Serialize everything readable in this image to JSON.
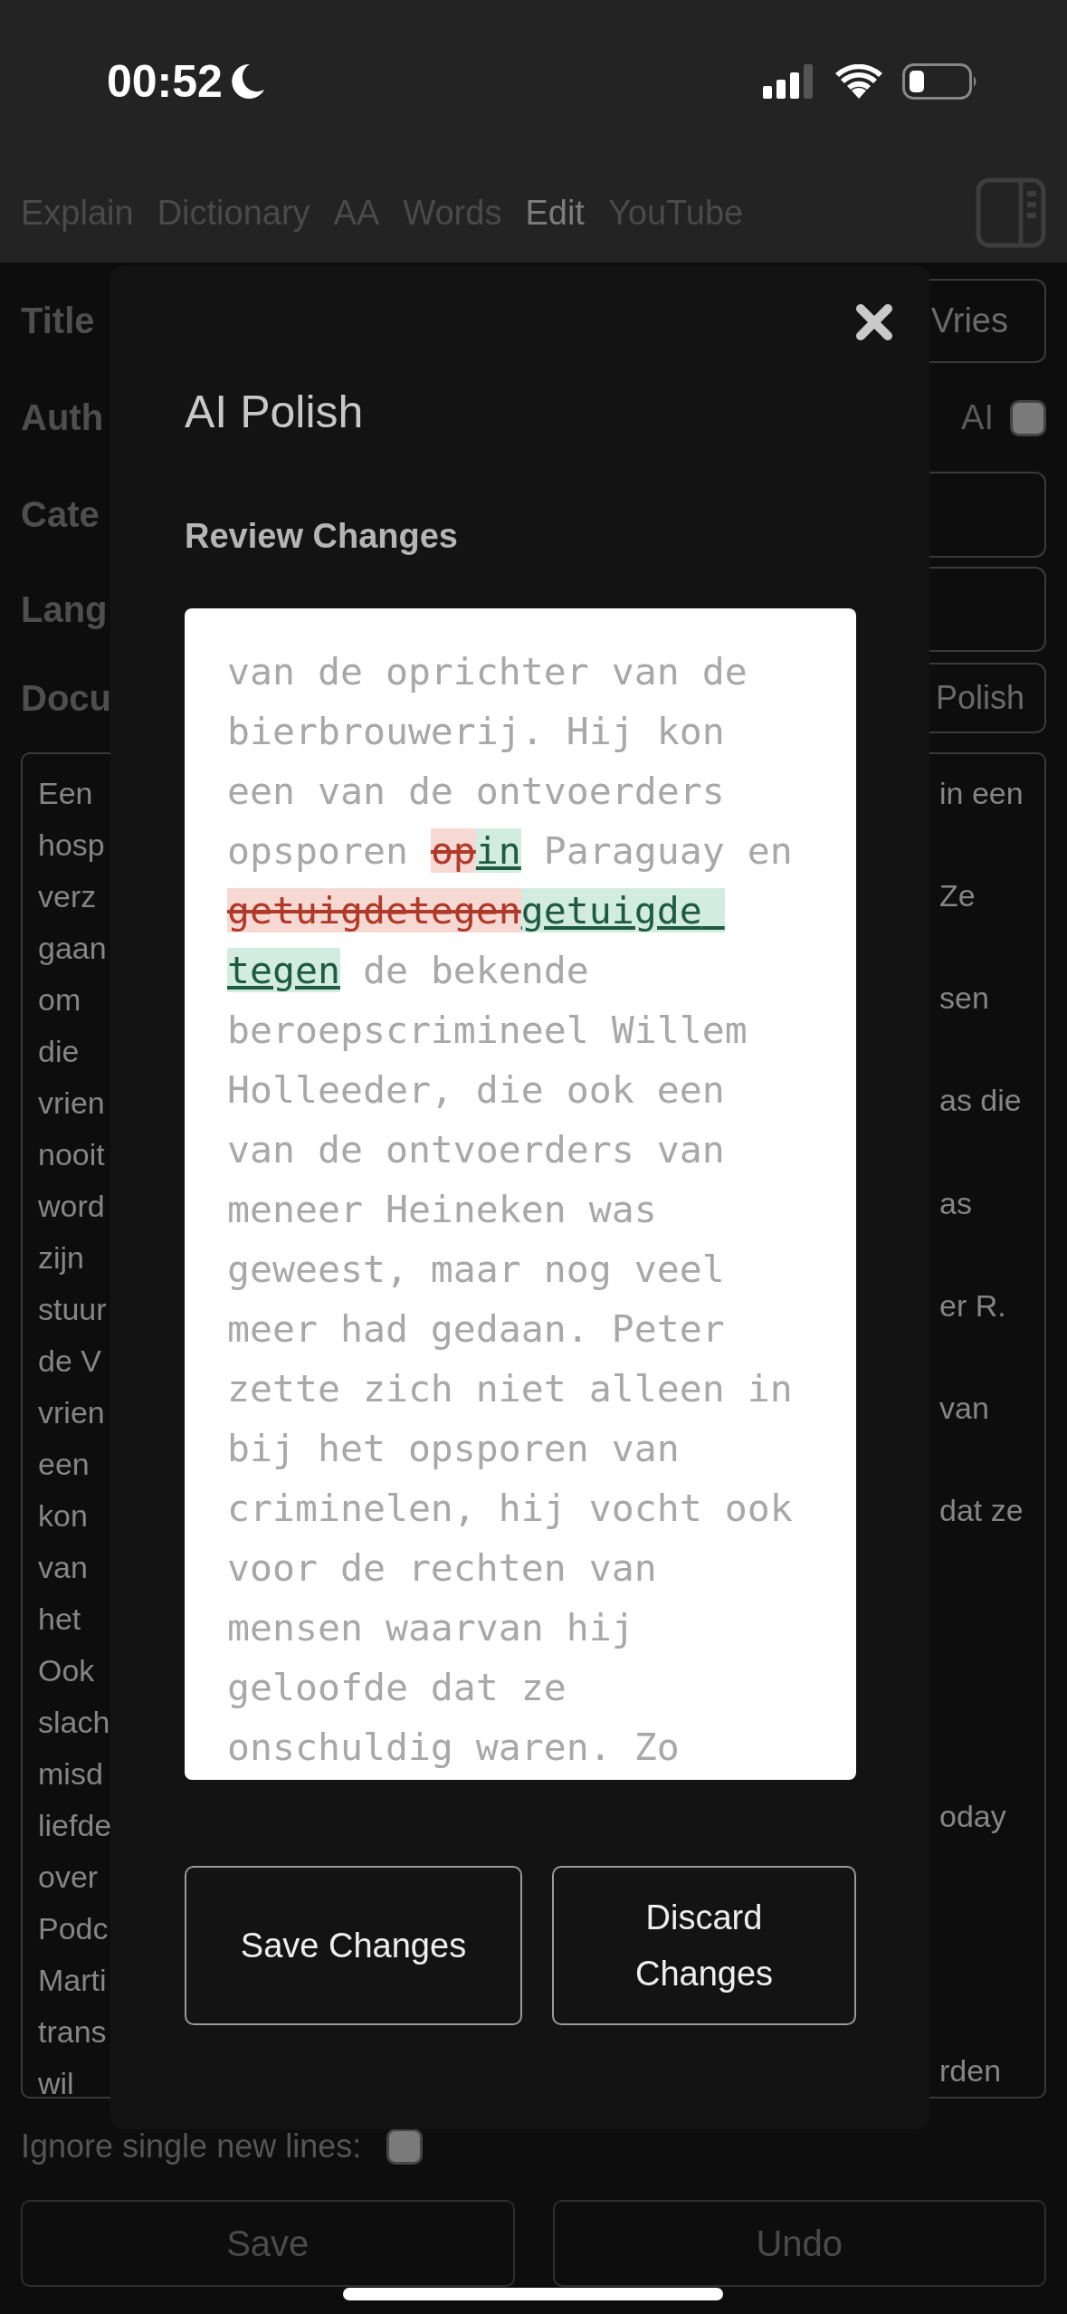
{
  "status_bar": {
    "time": "00:52"
  },
  "tabs": [
    {
      "label": "Explain",
      "selected": false
    },
    {
      "label": "Dictionary",
      "selected": false
    },
    {
      "label": "AA",
      "selected": false
    },
    {
      "label": "Words",
      "selected": false
    },
    {
      "label": "Edit",
      "selected": true
    },
    {
      "label": "YouTube",
      "selected": false
    }
  ],
  "form": {
    "title_label": "Title",
    "title_value": "Vries",
    "author_label": "Auth",
    "ai_label": "AI",
    "ai_checked": false,
    "category_label": "Cate",
    "language_label": "Lang",
    "document_label": "Docu",
    "polish_button": "Polish",
    "document_lines": [
      {
        "left": "Een",
        "right": "in een"
      },
      {
        "left": "hosp"
      },
      {
        "left": "verz",
        "right": "Ze"
      },
      {
        "left": "gaan"
      },
      {
        "left": "om",
        "right": "sen"
      },
      {
        "left": "die"
      },
      {
        "left": "vrien",
        "right": "as die"
      },
      {
        "left": "nooit"
      },
      {
        "left": "word",
        "right": "as"
      },
      {
        "left": "zijn"
      },
      {
        "left": "stuur",
        "right": "er R."
      },
      {
        "left": "de V"
      },
      {
        "left": "vrien",
        "right": "van"
      },
      {
        "left": "een"
      },
      {
        "left": "kon",
        "right": "dat ze"
      },
      {
        "left": "van"
      },
      {
        "left": "het"
      },
      {
        "left": "Ook"
      },
      {
        "left": "slach"
      },
      {
        "left": "misd"
      },
      {
        "left": "liefde",
        "right": "oday"
      },
      {
        "left": "over"
      },
      {
        "left": "Podc"
      },
      {
        "left": "Marti"
      },
      {
        "left": "trans"
      },
      {
        "left": "wil",
        "right": "rden"
      }
    ]
  },
  "ignore_newlines": {
    "label": "Ignore single new lines:",
    "checked": false
  },
  "buttons": [
    "Save",
    "Undo"
  ],
  "modal": {
    "title": "AI Polish",
    "heading": "Review Changes",
    "segments": [
      {
        "kind": "same",
        "text": "van de oprichter van de bierbrouwerij. Hij kon een van de ontvoerders opsporen "
      },
      {
        "kind": "removed",
        "text": "op"
      },
      {
        "kind": "added",
        "text": "in"
      },
      {
        "kind": "same",
        "text": " Paraguay en "
      },
      {
        "kind": "removed",
        "text": "getuigdetegen"
      },
      {
        "kind": "added",
        "text": "getuigde tegen"
      },
      {
        "kind": "same",
        "text": " de bekende beroepscrimineel Willem Holleeder, die ook een van de ontvoerders van meneer Heineken was geweest, maar nog veel meer had gedaan. Peter zette zich niet alleen in bij het opsporen van criminelen, hij vocht ook voor de rechten van mensen waarvan hij geloofde dat ze onschuldig waren. Zo"
      }
    ],
    "buttons": [
      "Save Changes",
      "Discard Changes"
    ]
  }
}
